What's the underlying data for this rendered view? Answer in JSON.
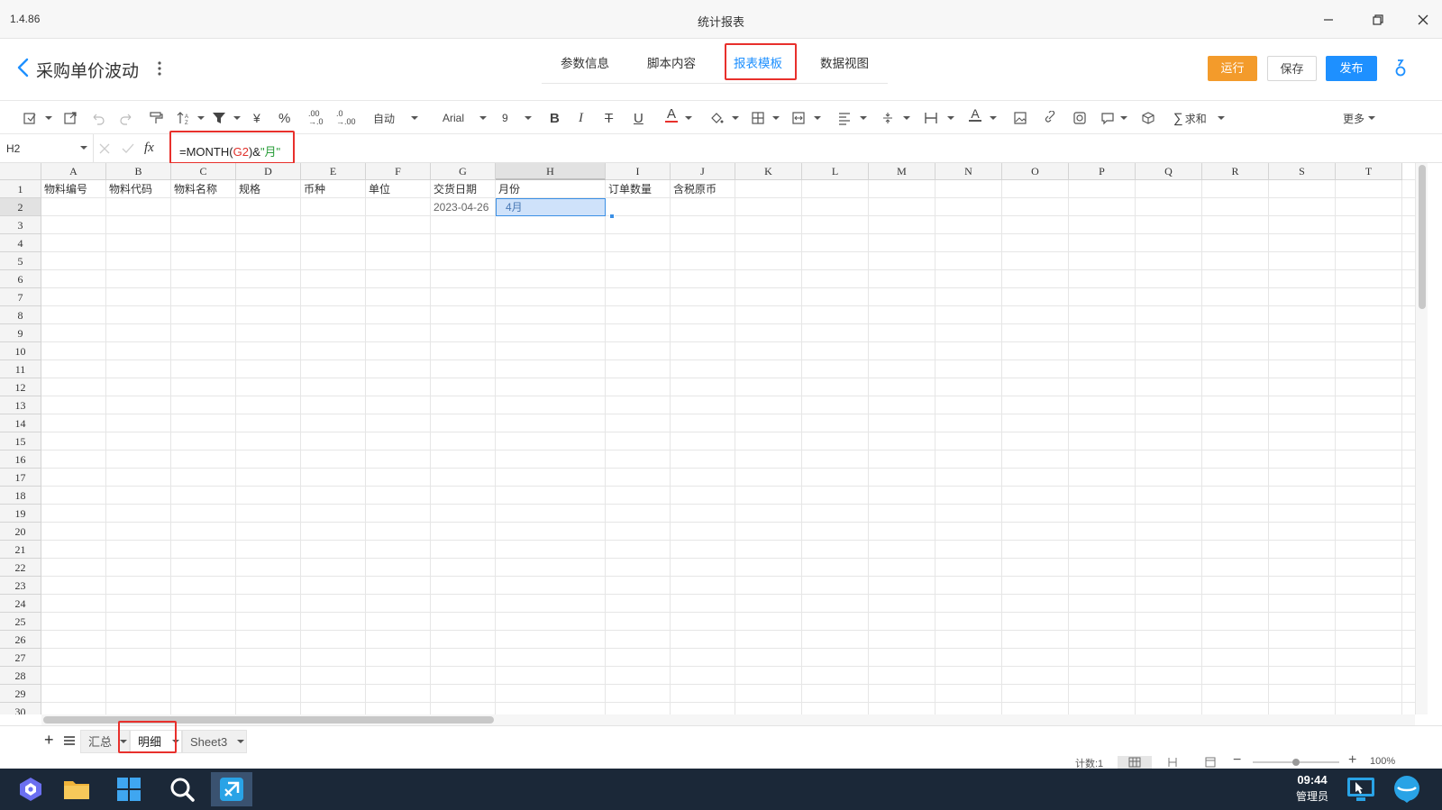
{
  "window": {
    "version": "1.4.86",
    "title": "统计报表"
  },
  "header": {
    "report_title": "采购单价波动",
    "tabs": [
      {
        "label": "参数信息",
        "active": false
      },
      {
        "label": "脚本内容",
        "active": false
      },
      {
        "label": "报表模板",
        "active": true
      },
      {
        "label": "数据视图",
        "active": false
      }
    ],
    "run_label": "运行",
    "save_label": "保存",
    "publish_label": "发布",
    "colors": {
      "accent": "#1e90ff",
      "run": "#f39b2b",
      "publish": "#1e90ff",
      "highlight_box": "#e8302c"
    }
  },
  "toolbar": {
    "number_format": "自动",
    "font_name": "Arial",
    "font_size": "9",
    "sum_label": "求和",
    "more_label": "更多"
  },
  "formula_bar": {
    "cell_ref": "H2",
    "fx_label": "fx",
    "formula_prefix": "=MONTH(",
    "formula_ref": "G2",
    "formula_mid": ")&",
    "formula_string": "\"月\""
  },
  "sheet": {
    "columns": [
      "A",
      "B",
      "C",
      "D",
      "E",
      "F",
      "G",
      "H",
      "I",
      "J",
      "K",
      "L",
      "M",
      "N",
      "O",
      "P",
      "Q",
      "R",
      "S",
      "T"
    ],
    "rows": [
      "1",
      "2",
      "3",
      "4",
      "5",
      "6",
      "7",
      "8",
      "9",
      "10",
      "11",
      "12",
      "13",
      "14",
      "15",
      "16",
      "17",
      "18",
      "19",
      "20",
      "21",
      "22",
      "23",
      "24",
      "25",
      "26",
      "27",
      "28",
      "29",
      "30"
    ],
    "headers": {
      "A": "物料编号",
      "B": "物料代码",
      "C": "物料名称",
      "D": "规格",
      "E": "币种",
      "F": "单位",
      "G": "交货日期",
      "H": "月份",
      "I": "订单数量",
      "J": "含税原币"
    },
    "row2": {
      "G": "2023-04-26",
      "H": "4月"
    },
    "selected_cell": "H2"
  },
  "sheet_tabs": [
    {
      "label": "汇总",
      "active": false
    },
    {
      "label": "明细",
      "active": true
    },
    {
      "label": "Sheet3",
      "active": false
    }
  ],
  "status": {
    "count_label": "计数:1",
    "zoom": "100%"
  },
  "taskbar": {
    "time": "09:44",
    "user": "管理员"
  }
}
